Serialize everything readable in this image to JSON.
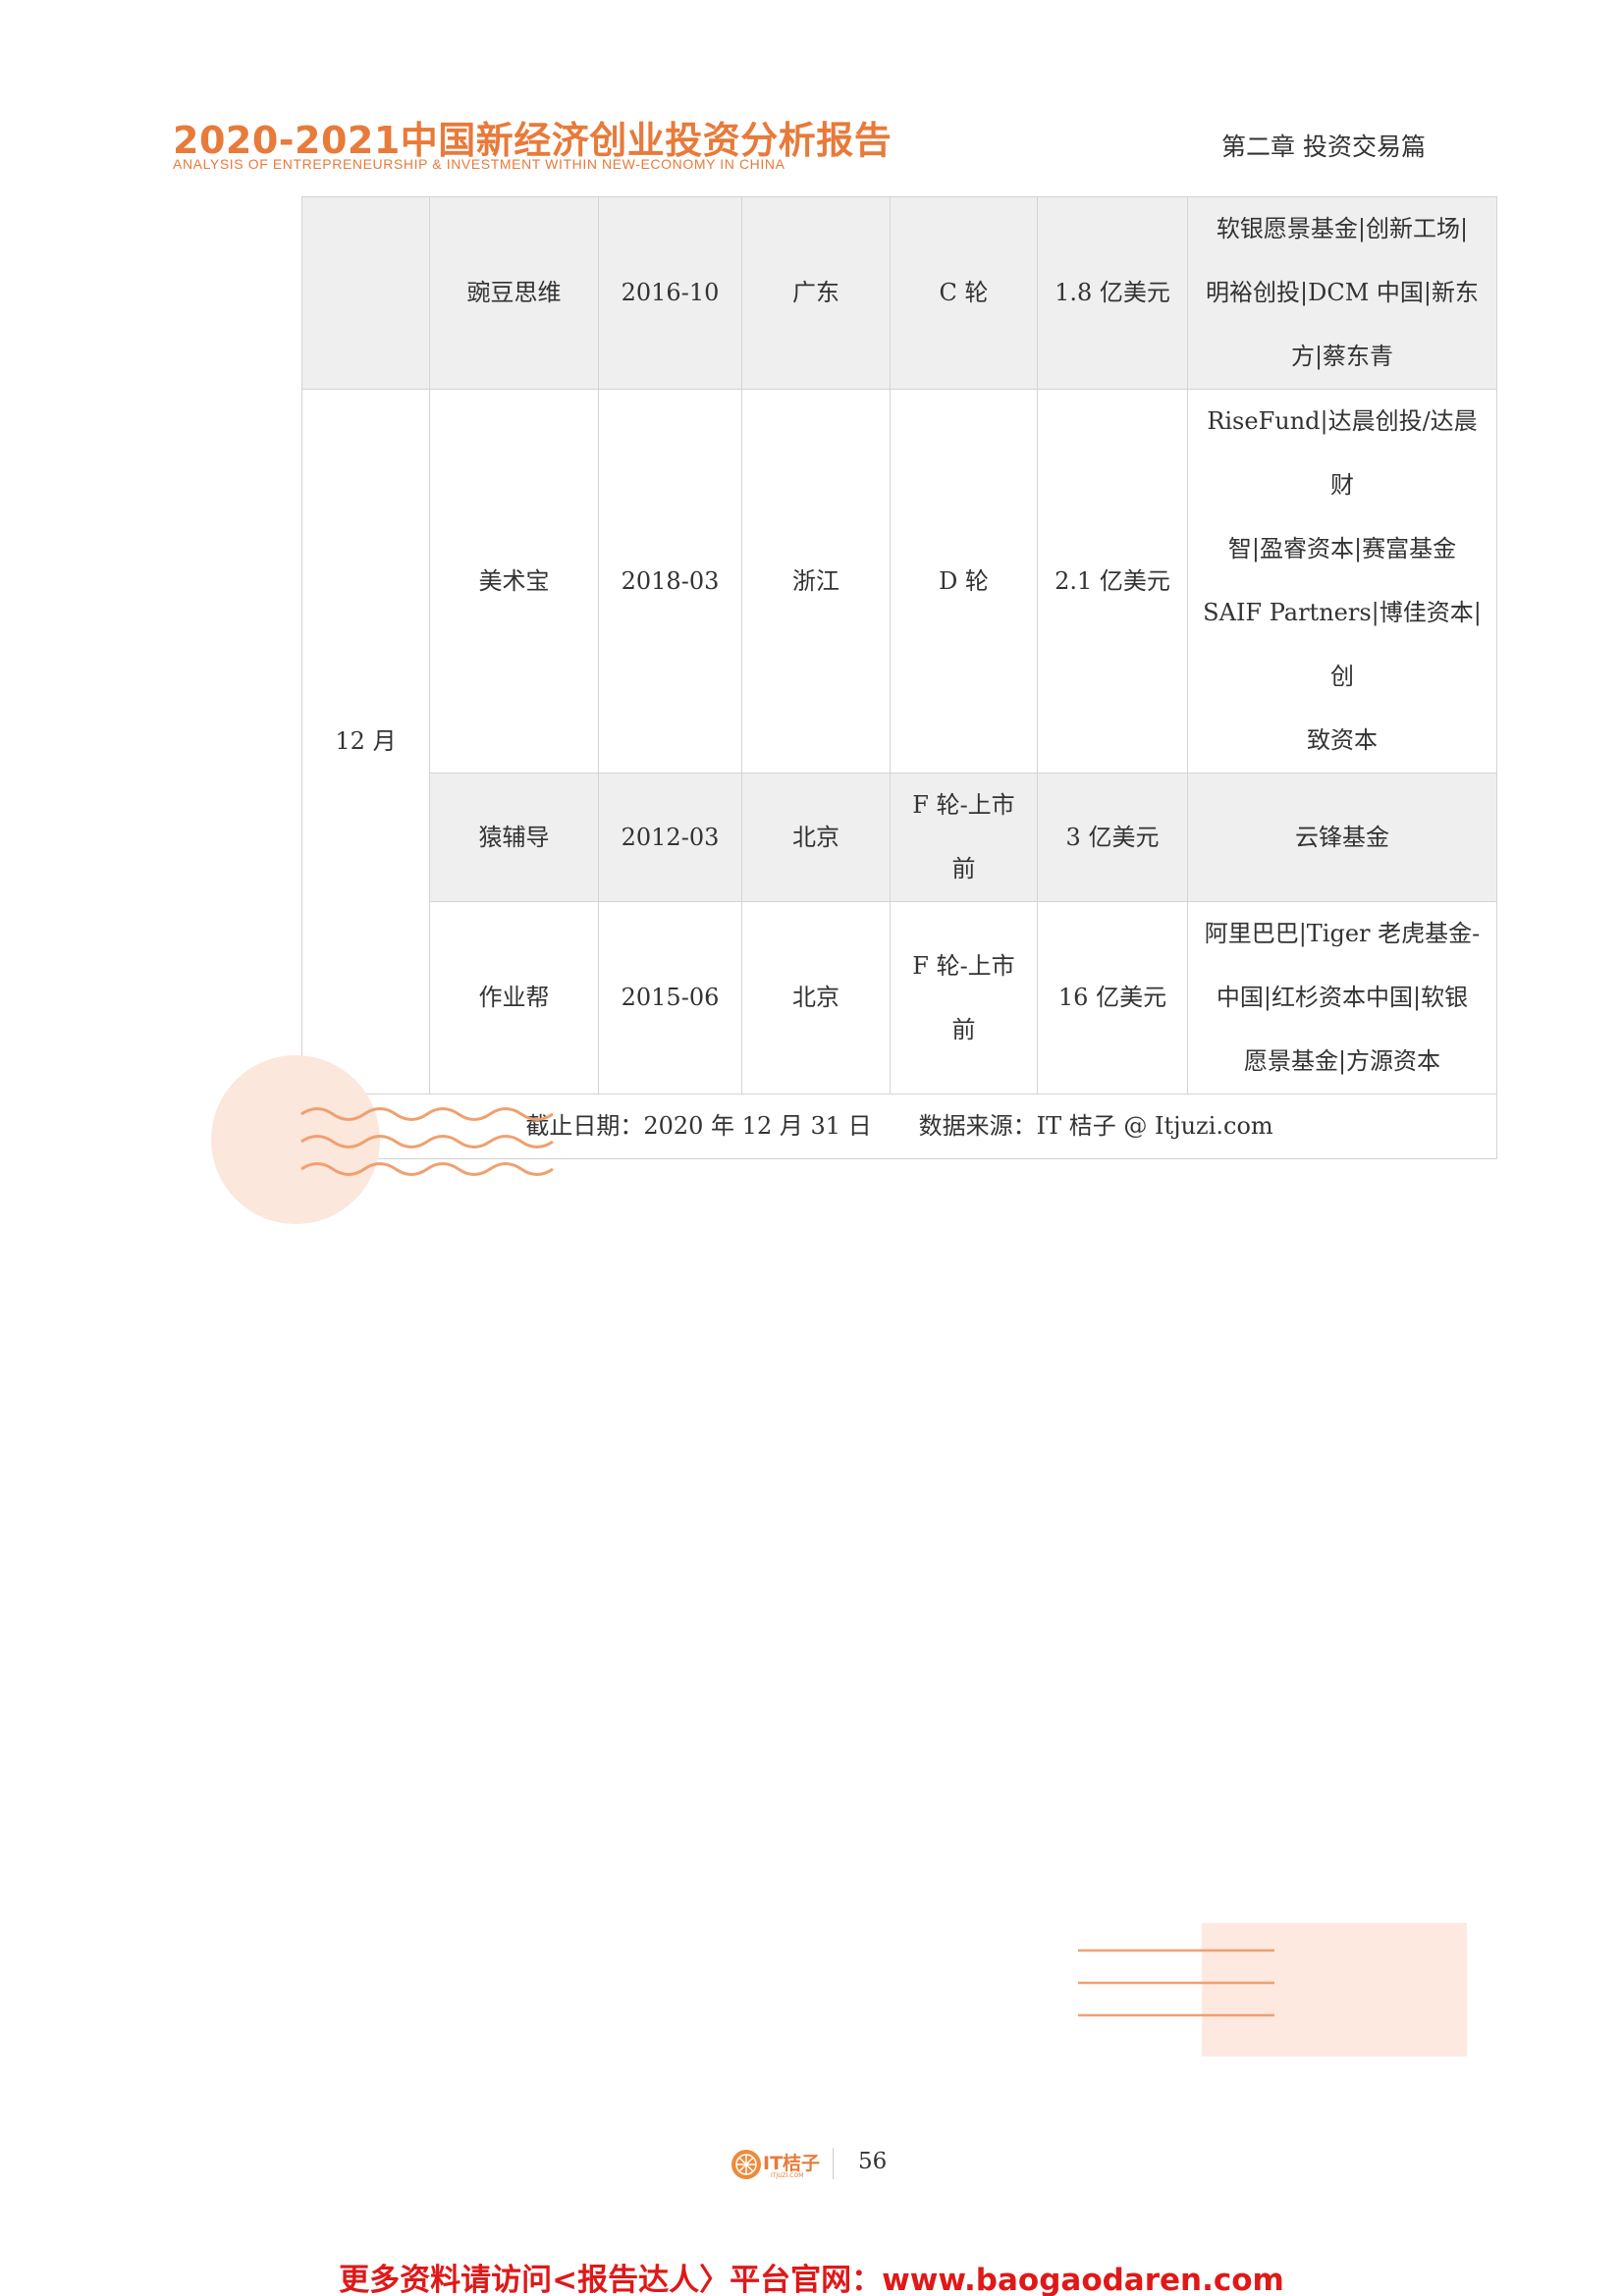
{
  "header": {
    "title": "2020-2021中国新经济创业投资分析报告",
    "subtitle": "ANALYSIS OF ENTREPRENEURSHIP & INVESTMENT  WITHIN NEW-ECONOMY  IN CHINA",
    "chapter": "第二章  投资交易篇"
  },
  "table": {
    "top_row": {
      "company": "豌豆思维",
      "date": "2016-10",
      "region": "广东",
      "round": "C 轮",
      "amount": "1.8 亿美元",
      "investors": [
        "软银愿景基金|创新工场|",
        "明裕创投|DCM 中国|新东",
        "方|蔡东青"
      ]
    },
    "month": "12 月",
    "rows": [
      {
        "company": "美术宝",
        "date": "2018-03",
        "region": "浙江",
        "round": [
          "D 轮"
        ],
        "amount": "2.1 亿美元",
        "investors": [
          "RiseFund|达晨创投/达晨财",
          "智|盈睿资本|赛富基金",
          "SAIF Partners|博佳资本|创",
          "致资本"
        ]
      },
      {
        "company": "猿辅导",
        "date": "2012-03",
        "region": "北京",
        "round": [
          "F 轮-上市",
          "前"
        ],
        "amount": "3 亿美元",
        "investors": [
          "云锋基金"
        ]
      },
      {
        "company": "作业帮",
        "date": "2015-06",
        "region": "北京",
        "round": [
          "F 轮-上市",
          "前"
        ],
        "amount": "16 亿美元",
        "investors": [
          "阿里巴巴|Tiger 老虎基金-",
          "中国|红杉资本中国|软银",
          "愿景基金|方源资本"
        ]
      }
    ],
    "footer": {
      "cutoff": "截止日期：2020 年 12 月 31 日",
      "source": "数据来源：IT 桔子 @ Itjuzi.com"
    }
  },
  "footer": {
    "logo_text": "IT桔子",
    "logo_sub": "ITJUZI.COM",
    "page_number": "56",
    "banner": "更多资料请访问<报告达人〉平台官网：www.baogaodaren.com"
  },
  "colors": {
    "accent": "#e87a3a",
    "banner": "#e01818",
    "shade": "#efefef",
    "deco": "#fbe7dc"
  }
}
